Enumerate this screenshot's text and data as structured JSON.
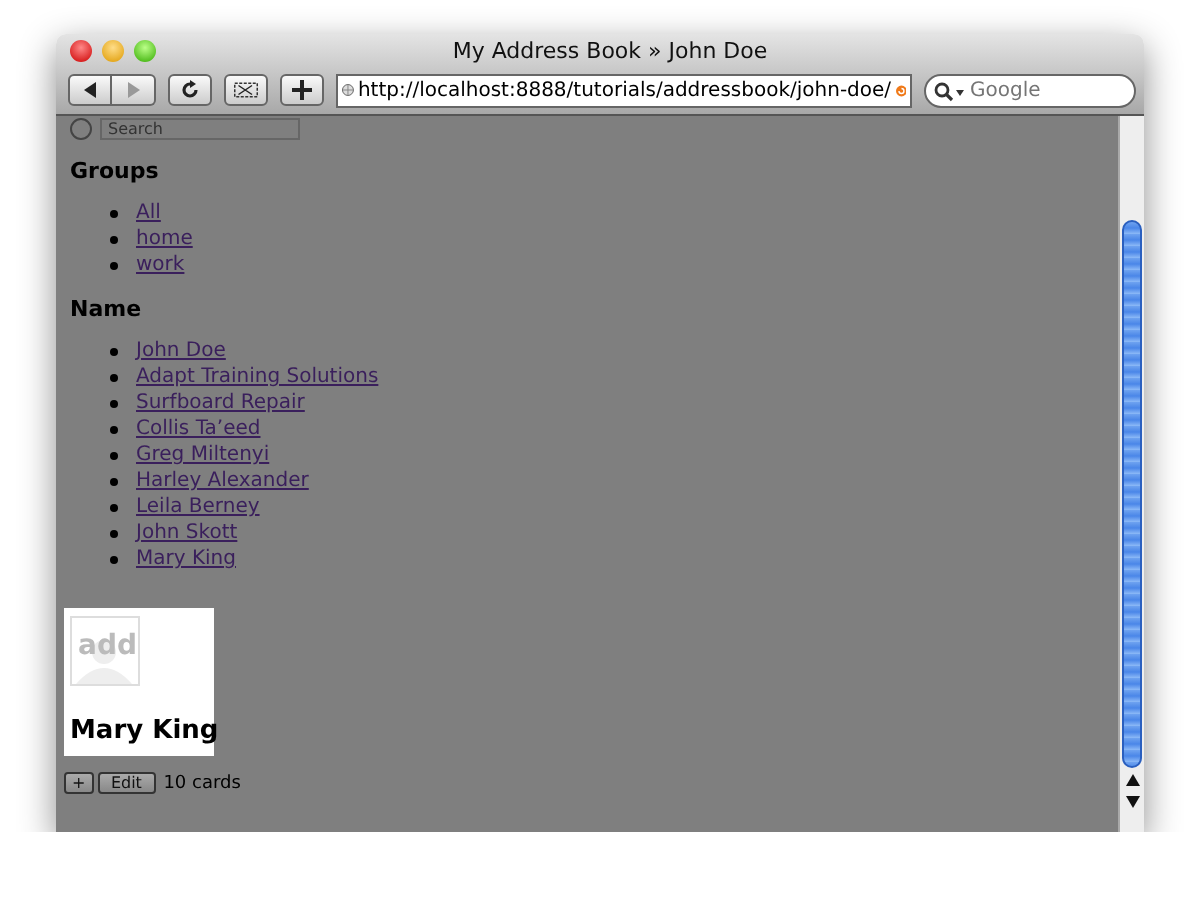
{
  "window": {
    "title": "My Address Book » John Doe"
  },
  "toolbar": {
    "url": "http://localhost:8888/tutorials/addressbook/john-doe/",
    "search": {
      "placeholder": "Google"
    }
  },
  "page": {
    "search": {
      "placeholder": "Search"
    },
    "groups": {
      "heading": "Groups",
      "items": [
        "All",
        "home",
        "work"
      ]
    },
    "names": {
      "heading": "Name",
      "items": [
        "John Doe",
        "Adapt Training Solutions",
        "Surfboard Repair",
        "Collis Ta’eed",
        "Greg Miltenyi",
        "Harley Alexander",
        "Leila Berney",
        "John Skott",
        "Mary King"
      ]
    },
    "card": {
      "photo_label": "add",
      "name": "Mary King"
    },
    "footer": {
      "add_button": "+",
      "edit_button": "Edit",
      "count": "10 cards"
    }
  }
}
